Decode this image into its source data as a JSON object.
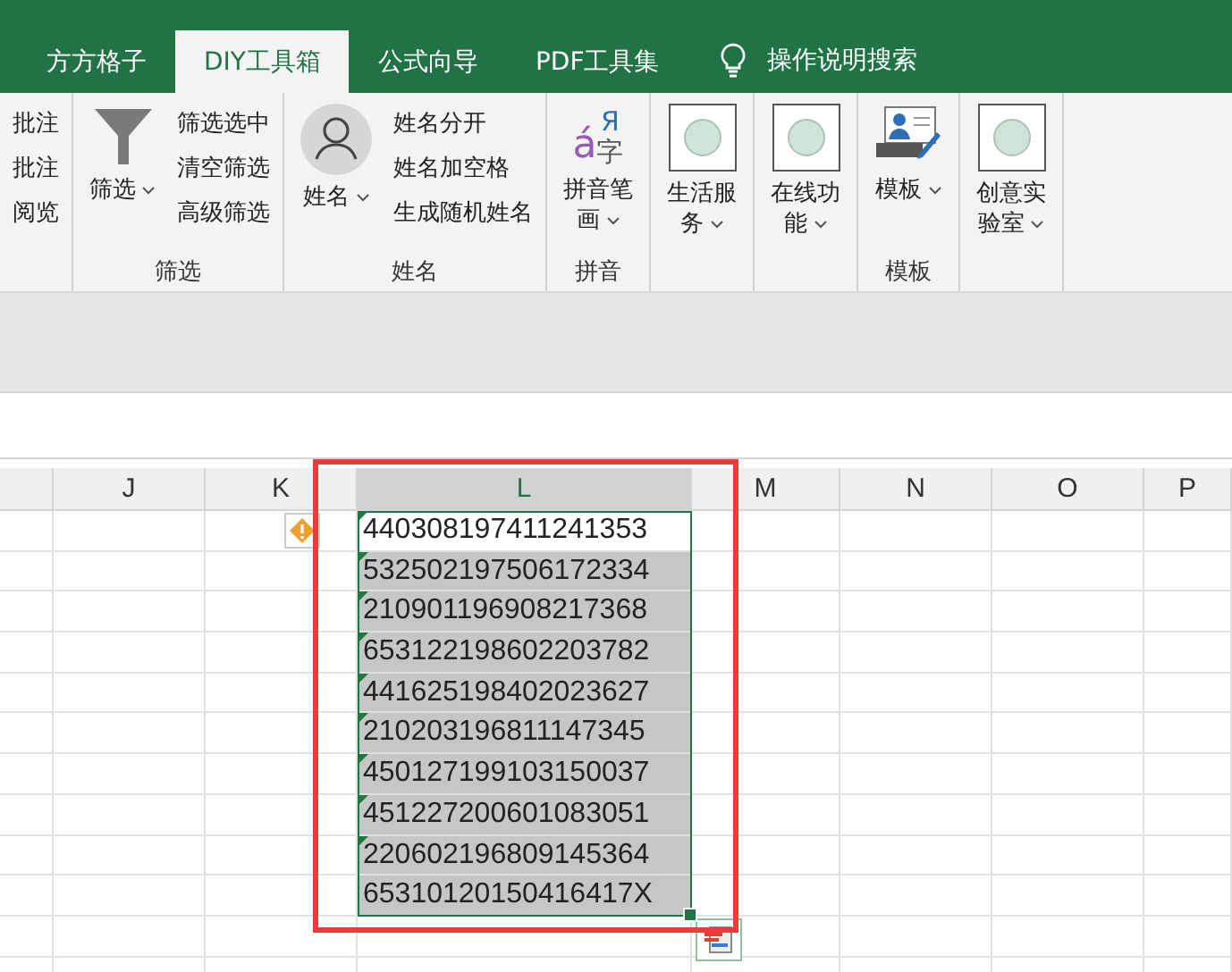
{
  "tabs": [
    {
      "label": "方方格子",
      "selected": false
    },
    {
      "label": "DIY工具箱",
      "selected": true
    },
    {
      "label": "公式向导",
      "selected": false
    },
    {
      "label": "PDF工具集",
      "selected": false
    }
  ],
  "help_search": {
    "label": "操作说明搜索"
  },
  "ribbon_groups": [
    {
      "items": [
        {
          "kind": "small",
          "label": "批注"
        },
        {
          "kind": "small",
          "label": "批注"
        },
        {
          "kind": "small",
          "label": "阅览"
        }
      ]
    },
    {
      "label": "筛选",
      "items": [
        {
          "kind": "funnel",
          "lines": [
            "筛选"
          ],
          "dropdown": true
        },
        {
          "kind": "small",
          "label": "筛选选中"
        },
        {
          "kind": "small",
          "label": "清空筛选"
        },
        {
          "kind": "small",
          "label": "高级筛选"
        }
      ]
    },
    {
      "label": "姓名",
      "items": [
        {
          "kind": "person",
          "lines": [
            "姓名"
          ],
          "dropdown": true
        },
        {
          "kind": "small",
          "label": "姓名分开"
        },
        {
          "kind": "small",
          "label": "姓名加空格"
        },
        {
          "kind": "small",
          "label": "生成随机姓名"
        }
      ]
    },
    {
      "label": "拼音",
      "items": [
        {
          "kind": "pinyin",
          "glyphs": [
            "á",
            "Я",
            "字"
          ],
          "lines": [
            "拼音笔",
            "画"
          ],
          "dropdown": true
        }
      ]
    },
    {
      "items": [
        {
          "kind": "blank",
          "lines": [
            "生活服",
            "务"
          ],
          "dropdown": true
        }
      ]
    },
    {
      "items": [
        {
          "kind": "blank",
          "lines": [
            "在线功",
            "能"
          ],
          "dropdown": true
        }
      ]
    },
    {
      "label": "模板",
      "items": [
        {
          "kind": "template",
          "lines": [
            "模板"
          ],
          "dropdown": true
        }
      ]
    },
    {
      "items": [
        {
          "kind": "blank",
          "lines": [
            "创意实",
            "验室"
          ],
          "dropdown": true
        }
      ]
    }
  ],
  "columns": [
    {
      "selected": false
    },
    {
      "label": "J",
      "selected": false
    },
    {
      "label": "K",
      "selected": false
    },
    {
      "label": "L",
      "selected": true
    },
    {
      "label": "M",
      "selected": false
    },
    {
      "label": "N",
      "selected": false
    },
    {
      "label": "O",
      "selected": false
    },
    {
      "label": "P",
      "selected": false
    }
  ],
  "cells": [
    {
      "value": "440308197411241353",
      "active": true,
      "error_flag": true
    },
    {
      "value": "532502197506172334",
      "active": false,
      "error_flag": true
    },
    {
      "value": "210901196908217368",
      "active": false,
      "error_flag": true
    },
    {
      "value": "653122198602203782",
      "active": false,
      "error_flag": true
    },
    {
      "value": "441625198402023627",
      "active": false,
      "error_flag": true
    },
    {
      "value": "210203196811147345",
      "active": false,
      "error_flag": true
    },
    {
      "value": "450127199103150037",
      "active": false,
      "error_flag": true
    },
    {
      "value": "451227200601083051",
      "active": false,
      "error_flag": true
    },
    {
      "value": "220602196809145364",
      "active": false,
      "error_flag": true
    },
    {
      "value": "65310120150416417X",
      "active": false,
      "error_flag": false
    }
  ]
}
